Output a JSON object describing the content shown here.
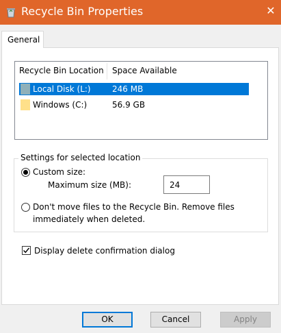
{
  "window": {
    "title": "Recycle Bin Properties",
    "close_glyph": "✕",
    "title_icon": "recycle-bin-icon"
  },
  "tabs": [
    {
      "label": "General",
      "selected": true
    }
  ],
  "locations": {
    "columns": [
      "Recycle Bin Location",
      "Space Available"
    ],
    "rows": [
      {
        "name": "Local Disk (L:)",
        "space": "246 MB",
        "selected": true,
        "icon": "drive-icon",
        "icon_color": "#8fb0b9"
      },
      {
        "name": "Windows (C:)",
        "space": "56.9 GB",
        "selected": false,
        "icon": "drive-icon",
        "icon_color": "#ffe08a"
      }
    ]
  },
  "settings": {
    "legend": "Settings for selected location",
    "custom_size_label": "Custom size:",
    "custom_size_selected": true,
    "max_size_label": "Maximum size (MB):",
    "max_size_value": "24",
    "no_move_label_line1": "Don't move files to the Recycle Bin. Remove files",
    "no_move_label_line2": "immediately when deleted.",
    "no_move_selected": false
  },
  "confirm": {
    "label": "Display delete confirmation dialog",
    "checked": true
  },
  "buttons": {
    "ok": "OK",
    "cancel": "Cancel",
    "apply": "Apply"
  },
  "colors": {
    "titlebar": "#e0662a",
    "selection": "#0078d7"
  }
}
